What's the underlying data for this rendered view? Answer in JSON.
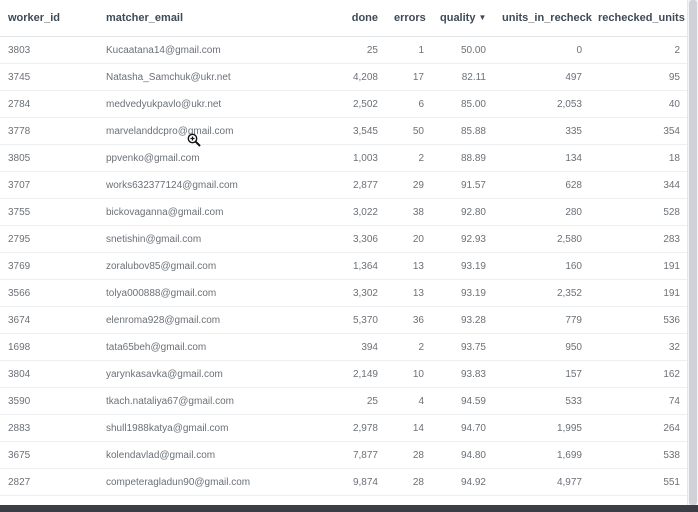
{
  "table": {
    "columns": [
      {
        "key": "worker_id",
        "label": "worker_id"
      },
      {
        "key": "matcher_email",
        "label": "matcher_email"
      },
      {
        "key": "done",
        "label": "done"
      },
      {
        "key": "errors",
        "label": "errors"
      },
      {
        "key": "quality",
        "label": "quality",
        "sort": "descending-arrow"
      },
      {
        "key": "units_in_recheck",
        "label": "units_in_recheck"
      },
      {
        "key": "rechecked_units",
        "label": "rechecked_units"
      }
    ],
    "rows": [
      [
        "3803",
        "Kucaatana14@gmail.com",
        "25",
        "1",
        "50.00",
        "0",
        "2"
      ],
      [
        "3745",
        "Natasha_Samchuk@ukr.net",
        "4,208",
        "17",
        "82.11",
        "497",
        "95"
      ],
      [
        "2784",
        "medvedyukpavlo@ukr.net",
        "2,502",
        "6",
        "85.00",
        "2,053",
        "40"
      ],
      [
        "3778",
        "marvelanddcpro@gmail.com",
        "3,545",
        "50",
        "85.88",
        "335",
        "354"
      ],
      [
        "3805",
        "ppvenko@gmail.com",
        "1,003",
        "2",
        "88.89",
        "134",
        "18"
      ],
      [
        "3707",
        "works632377124@gmail.com",
        "2,877",
        "29",
        "91.57",
        "628",
        "344"
      ],
      [
        "3755",
        "bickovaganna@gmail.com",
        "3,022",
        "38",
        "92.80",
        "280",
        "528"
      ],
      [
        "2795",
        "snetishin@gmail.com",
        "3,306",
        "20",
        "92.93",
        "2,580",
        "283"
      ],
      [
        "3769",
        "zoralubov85@gmail.com",
        "1,364",
        "13",
        "93.19",
        "160",
        "191"
      ],
      [
        "3566",
        "tolya000888@gmail.com",
        "3,302",
        "13",
        "93.19",
        "2,352",
        "191"
      ],
      [
        "3674",
        "elenroma928@gmail.com",
        "5,370",
        "36",
        "93.28",
        "779",
        "536"
      ],
      [
        "1698",
        "tata65beh@gmail.com",
        "394",
        "2",
        "93.75",
        "950",
        "32"
      ],
      [
        "3804",
        "yarynkasavka@gmail.com",
        "2,149",
        "10",
        "93.83",
        "157",
        "162"
      ],
      [
        "3590",
        "tkach.nataliya67@gmail.com",
        "25",
        "4",
        "94.59",
        "533",
        "74"
      ],
      [
        "2883",
        "shull1988katya@gmail.com",
        "2,978",
        "14",
        "94.70",
        "1,995",
        "264"
      ],
      [
        "3675",
        "kolendavlad@gmail.com",
        "7,877",
        "28",
        "94.80",
        "1,699",
        "538"
      ],
      [
        "2827",
        "competeragladun90@gmail.com",
        "9,874",
        "28",
        "94.92",
        "4,977",
        "551"
      ]
    ]
  },
  "cursor": {
    "icon": "zoom-in-cursor-icon"
  }
}
